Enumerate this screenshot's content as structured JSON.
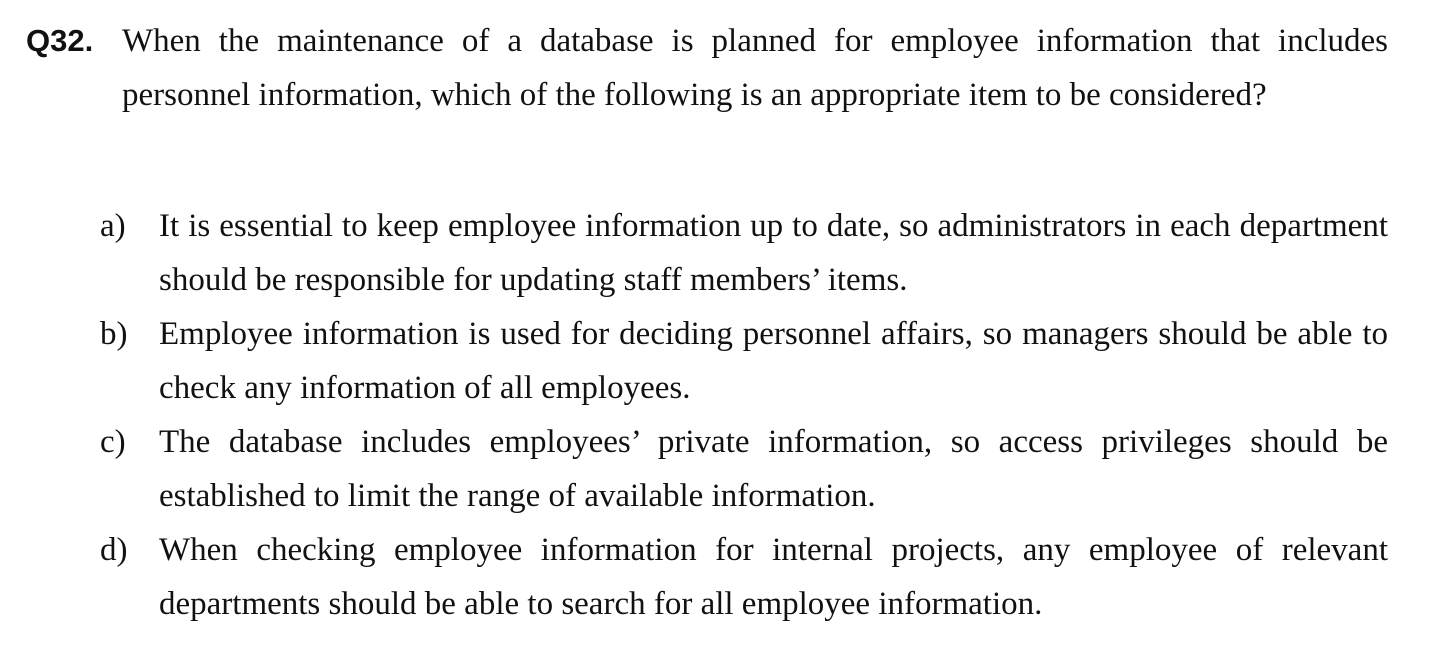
{
  "question": {
    "number": "Q32.",
    "text": "When the maintenance of a database is planned for employee information that includes personnel information, which of the following is an appropriate item to be considered?"
  },
  "options": [
    {
      "letter": "a)",
      "text": "It is essential to keep employee information up to date, so administrators in each department should be responsible for updating staff members’ items."
    },
    {
      "letter": "b)",
      "text": "Employee information is used for deciding personnel affairs, so managers should be able to check any information of all employees."
    },
    {
      "letter": "c)",
      "text": "The database includes employees’ private information, so access privileges should be established to limit the range of available information."
    },
    {
      "letter": "d)",
      "text": "When checking employee information for internal projects, any employee of relevant departments should be able to search for all employee information."
    }
  ]
}
